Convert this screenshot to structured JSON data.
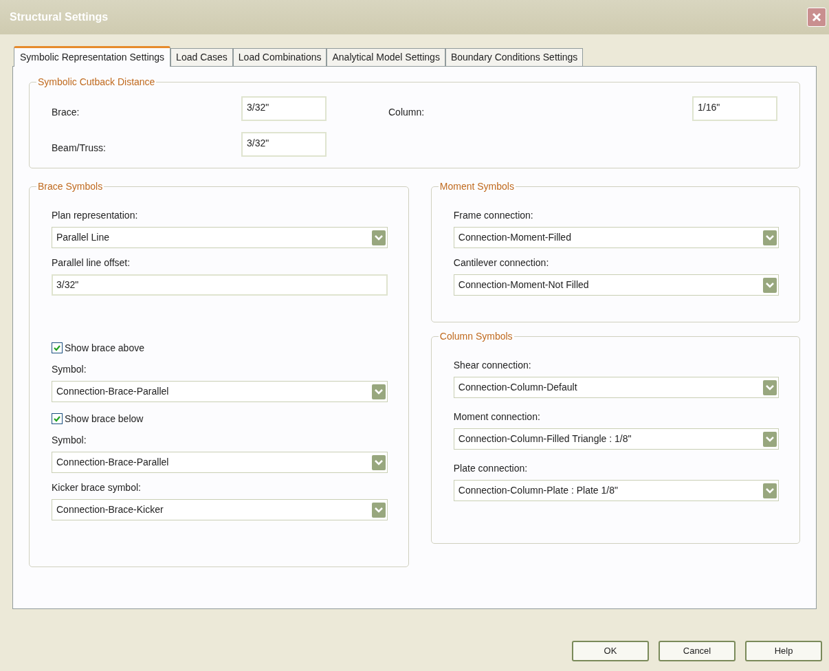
{
  "window": {
    "title": "Structural Settings"
  },
  "tabs": [
    {
      "label": "Symbolic Representation Settings",
      "selected": true
    },
    {
      "label": "Load Cases",
      "selected": false
    },
    {
      "label": "Load Combinations",
      "selected": false
    },
    {
      "label": "Analytical Model Settings",
      "selected": false
    },
    {
      "label": "Boundary Conditions Settings",
      "selected": false
    }
  ],
  "cutback": {
    "title": "Symbolic Cutback Distance",
    "fields": [
      {
        "label": "Brace:",
        "value": "3/32\""
      },
      {
        "label": "Column:",
        "value": "1/16\""
      },
      {
        "label": "Beam/Truss:",
        "value": "3/32\""
      }
    ]
  },
  "brace_symbols": {
    "title": "Brace Symbols",
    "sections": [
      [
        {
          "kind": "label",
          "text": "Plan representation:"
        },
        {
          "kind": "dropdown",
          "value": "Parallel Line"
        },
        {
          "kind": "label",
          "text": "Parallel line offset:"
        },
        {
          "kind": "field",
          "value": "3/32\""
        }
      ],
      [
        {
          "kind": "checkbox",
          "label": "Show brace above",
          "checked": true
        },
        {
          "kind": "label",
          "text": "Symbol:"
        },
        {
          "kind": "dropdown",
          "value": "Connection-Brace-Parallel"
        },
        {
          "kind": "checkbox",
          "label": "Show brace below",
          "checked": true
        },
        {
          "kind": "label",
          "text": "Symbol:"
        },
        {
          "kind": "dropdown",
          "value": "Connection-Brace-Parallel"
        },
        {
          "kind": "label",
          "text": "Kicker brace symbol:"
        },
        {
          "kind": "dropdown",
          "value": "Connection-Brace-Kicker"
        }
      ]
    ]
  },
  "moment_symbols": {
    "title": "Moment Symbols",
    "sections": [
      [
        {
          "kind": "label",
          "text": "Frame connection:"
        },
        {
          "kind": "dropdown",
          "value": "Connection-Moment-Filled"
        },
        {
          "kind": "label",
          "text": "Cantilever connection:"
        },
        {
          "kind": "dropdown",
          "value": "Connection-Moment-Not Filled"
        }
      ]
    ]
  },
  "column_symbols": {
    "title": "Column Symbols",
    "sections": [
      [
        {
          "kind": "label",
          "text": "Shear connection:"
        },
        {
          "kind": "dropdown",
          "value": "Connection-Column-Default"
        },
        {
          "kind": "label",
          "text": "Moment connection:"
        },
        {
          "kind": "dropdown",
          "value": "Connection-Column-Filled Triangle : 1/8\""
        },
        {
          "kind": "label",
          "text": "Plate connection:"
        },
        {
          "kind": "dropdown",
          "value": "Connection-Column-Plate : Plate 1/8\""
        }
      ]
    ]
  },
  "buttons": [
    "OK",
    "Cancel",
    "Help"
  ]
}
